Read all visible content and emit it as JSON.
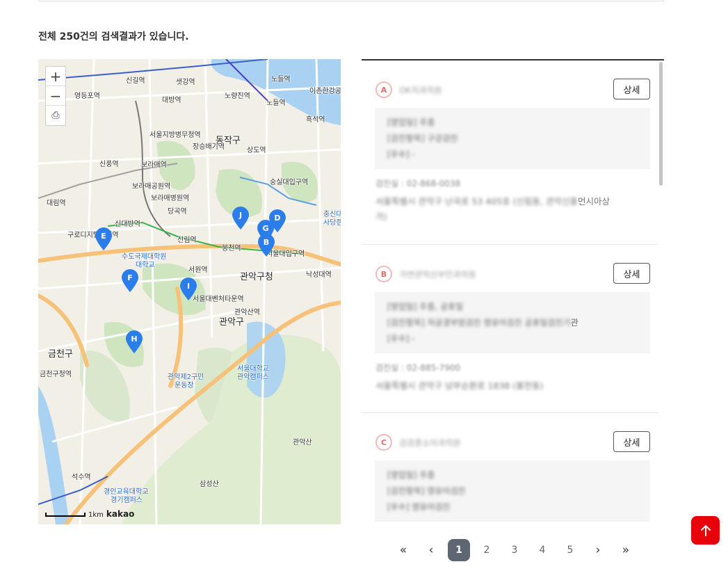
{
  "result_text": "전체 250건의 검색결과가 있습니다.",
  "map": {
    "zoom_in": "+",
    "zoom_out": "−",
    "print": "⎙",
    "scale_label": "1km",
    "brand": "kakao",
    "labels": [
      {
        "t": "신길역"
      },
      {
        "t": "샛강역"
      },
      {
        "t": "노들역"
      },
      {
        "t": "영등포역"
      },
      {
        "t": "대방역"
      },
      {
        "t": "노량진역"
      },
      {
        "t": "노들역"
      },
      {
        "t": "이촌한강공"
      },
      {
        "t": "흑석역"
      },
      {
        "t": "서울지방병무청역"
      },
      {
        "t": "동작구"
      },
      {
        "t": "장승배기역"
      },
      {
        "t": "상도역"
      },
      {
        "t": "신풍역"
      },
      {
        "t": "보라매역"
      },
      {
        "t": "숭실대입구역"
      },
      {
        "t": "보라매공원역"
      },
      {
        "t": "보라매병원역"
      },
      {
        "t": "대림역"
      },
      {
        "t": "당곡역"
      },
      {
        "t": "신대방역"
      },
      {
        "t": "구로디지털단지역"
      },
      {
        "t": "신림역"
      },
      {
        "t": "봉천역"
      },
      {
        "t": "서울대입구역"
      },
      {
        "t": "수도국제대학원"
      },
      {
        "t": "대학교"
      },
      {
        "t": "서원역"
      },
      {
        "t": "관악구청"
      },
      {
        "t": "낙성대역"
      },
      {
        "t": "서울대벤처타운역"
      },
      {
        "t": "관악산역"
      },
      {
        "t": "관악구"
      },
      {
        "t": "금천구"
      },
      {
        "t": "금천구청역"
      },
      {
        "t": "관악제2구민"
      },
      {
        "t": "운동장"
      },
      {
        "t": "서울대학교"
      },
      {
        "t": "관악캠퍼스"
      },
      {
        "t": "관악산"
      },
      {
        "t": "삼성산"
      },
      {
        "t": "석수역"
      },
      {
        "t": "경인교육대학교"
      },
      {
        "t": "경기캠퍼스"
      },
      {
        "t": "충신대"
      },
      {
        "t": "사당캠"
      }
    ],
    "markers": [
      "J",
      "D",
      "G",
      "B",
      "E",
      "F",
      "I",
      "H"
    ]
  },
  "list": [
    {
      "icon": "A",
      "name": "OK치과의원",
      "detail_label": "상세",
      "info": [
        "[영업일] 주중",
        "[검진항목] 구강검진",
        "[우수] -"
      ],
      "phone": "검진실 : 02-868-0038",
      "address_blur": "서울특별시 관악구 난곡로 53 405호 (신림동, 관악신흥",
      "address_clear": "먼시아상",
      "address_tail": "가)"
    },
    {
      "icon": "B",
      "name": "가연관악산부인과의원",
      "detail_label": "상세",
      "info": [
        "[영업일] 주중, 공휴일",
        "[검진항목] 자궁경부암검진 영유아검진 공휴일검진기",
        "[우수] -"
      ],
      "info_clear": "관",
      "phone": "검진실 : 02-885-7900",
      "address_blur": "서울특별시 관악구 남부순환로 1838 (봉천동)"
    },
    {
      "icon": "C",
      "name": "검검훈소아과의원",
      "detail_label": "상세",
      "info": [
        "[영업일] 주중",
        "[검진항목] 영유아검진",
        "[우수] 영유아검진"
      ]
    }
  ],
  "pagination": {
    "first": "«",
    "prev": "‹",
    "pages": [
      "1",
      "2",
      "3",
      "4",
      "5"
    ],
    "current": "1",
    "next": "›",
    "last": "»"
  },
  "colors": {
    "accent_red": "#e8000b",
    "marker_blue": "#2b7de9",
    "pager_active": "#5f6673"
  },
  "top_button_icon": "arrow-up-icon"
}
